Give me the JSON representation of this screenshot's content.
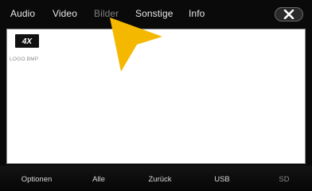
{
  "tabs": [
    {
      "label": "Audio",
      "active": false
    },
    {
      "label": "Video",
      "active": false
    },
    {
      "label": "Bilder",
      "active": true
    },
    {
      "label": "Sonstige",
      "active": false
    },
    {
      "label": "Info",
      "active": false
    }
  ],
  "close_icon": "close-icon",
  "files": [
    {
      "name": "LOGO.BMP",
      "thumbnail_text": "4X"
    }
  ],
  "bottom": {
    "optionen": "Optionen",
    "alle": "Alle",
    "zurueck": "Zurück",
    "usb": "USB",
    "sd": "SD"
  },
  "colors": {
    "accent_arrow": "#f5b800",
    "background": "#0a0a0a",
    "panel": "#ffffff"
  }
}
